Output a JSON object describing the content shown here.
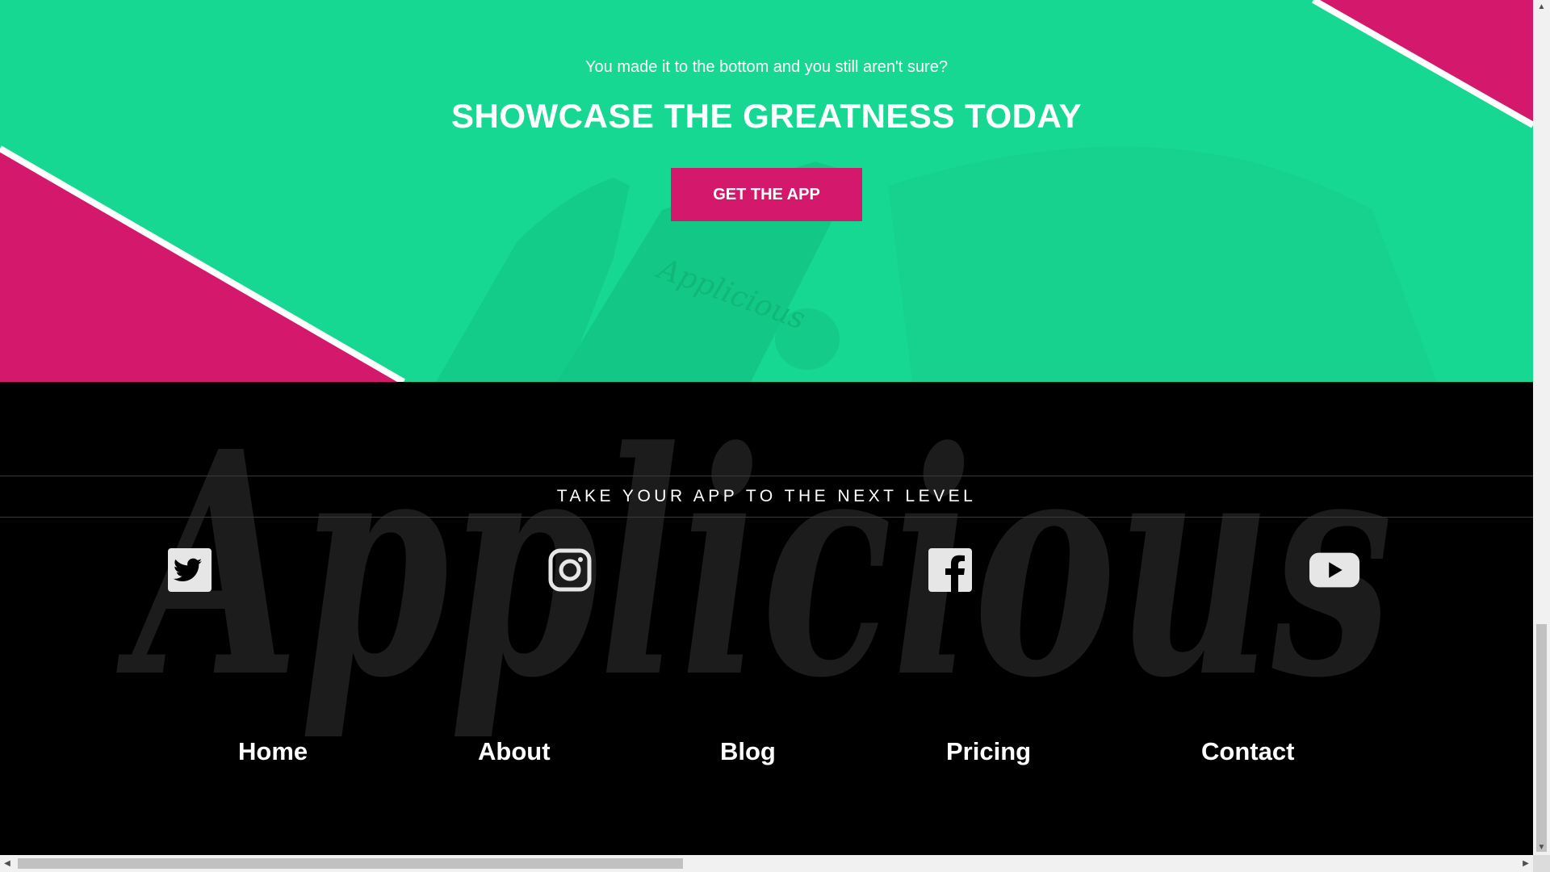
{
  "cta": {
    "subtitle": "You made it to the bottom and you still aren't sure?",
    "title": "SHOWCASE THE GREATNESS TODAY",
    "button_label": "GET THE APP"
  },
  "footer": {
    "tagline": "TAKE YOUR APP TO THE NEXT LEVEL",
    "social_icons": [
      "twitter-icon",
      "instagram-icon",
      "facebook-icon",
      "youtube-icon"
    ],
    "nav": [
      {
        "label": "Home"
      },
      {
        "label": "About"
      },
      {
        "label": "Blog"
      },
      {
        "label": "Pricing"
      },
      {
        "label": "Contact"
      }
    ]
  },
  "colors": {
    "accent_green": "#17d893",
    "accent_pink": "#d4186b",
    "footer_bg": "#000000",
    "wordmark": "#1c1c1c",
    "icon": "#e6e6e6"
  }
}
